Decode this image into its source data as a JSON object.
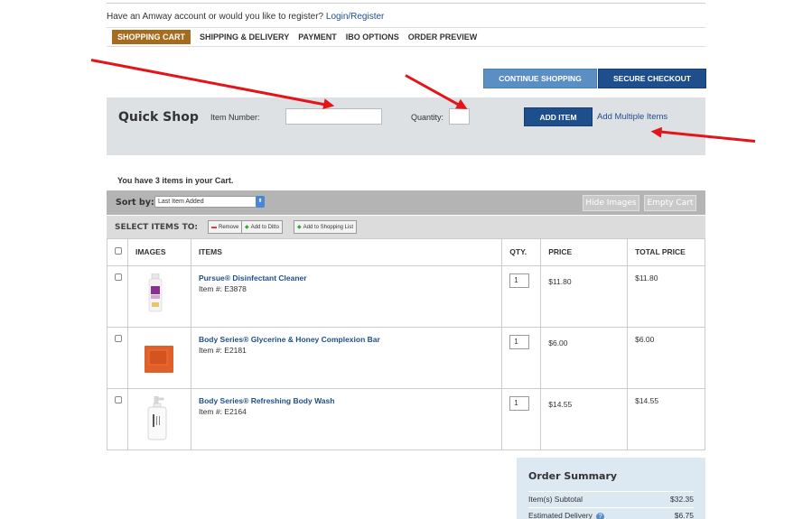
{
  "account": {
    "prompt": "Have an Amway account or would you like to register?",
    "link": "Login/Register"
  },
  "steps": [
    {
      "label": "SHOPPING CART",
      "active": true
    },
    {
      "label": "SHIPPING & DELIVERY",
      "active": false
    },
    {
      "label": "PAYMENT",
      "active": false
    },
    {
      "label": "IBO OPTIONS",
      "active": false
    },
    {
      "label": "ORDER PREVIEW",
      "active": false
    }
  ],
  "buttons": {
    "continue_shopping": "CONTINUE SHOPPING",
    "secure_checkout": "SECURE CHECKOUT"
  },
  "quick_shop": {
    "title": "Quick Shop",
    "item_number_label": "Item Number:",
    "item_number_value": "",
    "quantity_label": "Quantity:",
    "quantity_value": "",
    "add_item": "ADD ITEM",
    "add_multiple": "Add Multiple Items"
  },
  "cart": {
    "count_text": "You have 3 items in your Cart.",
    "sort_label": "Sort by:",
    "sort_value": "Last Item Added",
    "hide_images": "Hide Images",
    "empty_cart": "Empty Cart",
    "select_items_label": "SELECT ITEMS TO:",
    "actions": {
      "remove": "Remove",
      "add_to_ditto": "Add to Ditto",
      "add_to_list": "Add to Shopping List"
    },
    "columns": {
      "images": "IMAGES",
      "items": "ITEMS",
      "qty": "QTY.",
      "price": "PRICE",
      "total": "TOTAL PRICE"
    },
    "items": [
      {
        "name": "Pursue® Disinfectant Cleaner",
        "item_no": "Item #: E3878",
        "qty": "1",
        "price": "$11.80",
        "total": "$11.80"
      },
      {
        "name": "Body Series® Glycerine & Honey Complexion Bar",
        "item_no": "Item #: E2181",
        "qty": "1",
        "price": "$6.00",
        "total": "$6.00"
      },
      {
        "name": "Body Series® Refreshing Body Wash",
        "item_no": "Item #: E2164",
        "qty": "1",
        "price": "$14.55",
        "total": "$14.55"
      }
    ]
  },
  "summary": {
    "title": "Order Summary",
    "subtotal_label": "Item(s) Subtotal",
    "subtotal_value": "$32.35",
    "delivery_label": "Estimated Delivery",
    "delivery_value": "$6.75"
  },
  "colors": {
    "accent_blue": "#1f4e8c",
    "active_step": "#a66b1e",
    "annotation_red": "#e3151a"
  }
}
